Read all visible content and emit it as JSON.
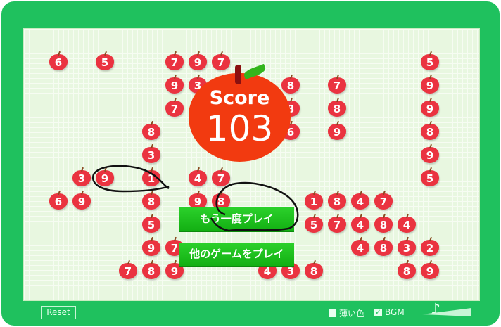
{
  "score": {
    "label": "Score",
    "value": "103"
  },
  "buttons": {
    "replay": "もう一度プレイ",
    "other_games": "他のゲームをプレイ",
    "reset": "Reset"
  },
  "options": {
    "light_color": {
      "label": "薄い色",
      "checked": false
    },
    "bgm": {
      "label": "BGM",
      "checked": true,
      "mark": "✓"
    }
  },
  "volume": {
    "icon": "music-note-icon",
    "glyph": "♪",
    "level": 1.0
  },
  "apples": [
    {
      "r": 0,
      "c": 0,
      "n": "6"
    },
    {
      "r": 0,
      "c": 2,
      "n": "5"
    },
    {
      "r": 0,
      "c": 5,
      "n": "7"
    },
    {
      "r": 0,
      "c": 6,
      "n": "9"
    },
    {
      "r": 0,
      "c": 7,
      "n": "7"
    },
    {
      "r": 0,
      "c": 16,
      "n": "5"
    },
    {
      "r": 1,
      "c": 5,
      "n": "9"
    },
    {
      "r": 1,
      "c": 6,
      "n": "3"
    },
    {
      "r": 1,
      "c": 10,
      "n": "8"
    },
    {
      "r": 1,
      "c": 12,
      "n": "7"
    },
    {
      "r": 1,
      "c": 16,
      "n": "9"
    },
    {
      "r": 2,
      "c": 5,
      "n": "7"
    },
    {
      "r": 2,
      "c": 10,
      "n": "8"
    },
    {
      "r": 2,
      "c": 12,
      "n": "8"
    },
    {
      "r": 2,
      "c": 16,
      "n": "9"
    },
    {
      "r": 3,
      "c": 4,
      "n": "8"
    },
    {
      "r": 3,
      "c": 10,
      "n": "6"
    },
    {
      "r": 3,
      "c": 12,
      "n": "9"
    },
    {
      "r": 3,
      "c": 16,
      "n": "8"
    },
    {
      "r": 4,
      "c": 4,
      "n": "3"
    },
    {
      "r": 4,
      "c": 16,
      "n": "9"
    },
    {
      "r": 5,
      "c": 1,
      "n": "3"
    },
    {
      "r": 5,
      "c": 2,
      "n": "9"
    },
    {
      "r": 5,
      "c": 4,
      "n": "1"
    },
    {
      "r": 5,
      "c": 6,
      "n": "4"
    },
    {
      "r": 5,
      "c": 7,
      "n": "7"
    },
    {
      "r": 5,
      "c": 16,
      "n": "5"
    },
    {
      "r": 6,
      "c": 0,
      "n": "6"
    },
    {
      "r": 6,
      "c": 1,
      "n": "9"
    },
    {
      "r": 6,
      "c": 4,
      "n": "8"
    },
    {
      "r": 6,
      "c": 6,
      "n": "9"
    },
    {
      "r": 6,
      "c": 7,
      "n": "8"
    },
    {
      "r": 6,
      "c": 11,
      "n": "1"
    },
    {
      "r": 6,
      "c": 12,
      "n": "8"
    },
    {
      "r": 6,
      "c": 13,
      "n": "4"
    },
    {
      "r": 6,
      "c": 14,
      "n": "7"
    },
    {
      "r": 7,
      "c": 4,
      "n": "5"
    },
    {
      "r": 7,
      "c": 11,
      "n": "5"
    },
    {
      "r": 7,
      "c": 12,
      "n": "7"
    },
    {
      "r": 7,
      "c": 13,
      "n": "4"
    },
    {
      "r": 7,
      "c": 14,
      "n": "8"
    },
    {
      "r": 7,
      "c": 15,
      "n": "4"
    },
    {
      "r": 8,
      "c": 4,
      "n": "9"
    },
    {
      "r": 8,
      "c": 5,
      "n": "7"
    },
    {
      "r": 8,
      "c": 13,
      "n": "4"
    },
    {
      "r": 8,
      "c": 14,
      "n": "8"
    },
    {
      "r": 8,
      "c": 15,
      "n": "3"
    },
    {
      "r": 8,
      "c": 16,
      "n": "2"
    },
    {
      "r": 9,
      "c": 3,
      "n": "7"
    },
    {
      "r": 9,
      "c": 4,
      "n": "8"
    },
    {
      "r": 9,
      "c": 5,
      "n": "9"
    },
    {
      "r": 9,
      "c": 9,
      "n": "4"
    },
    {
      "r": 9,
      "c": 10,
      "n": "3"
    },
    {
      "r": 9,
      "c": 11,
      "n": "8"
    },
    {
      "r": 9,
      "c": 15,
      "n": "8"
    },
    {
      "r": 9,
      "c": 16,
      "n": "9"
    }
  ],
  "colors": {
    "frame": "#1fc15e",
    "apple": "#ea3340",
    "score_apple": "#f23a10",
    "button": "#1cc01c"
  }
}
